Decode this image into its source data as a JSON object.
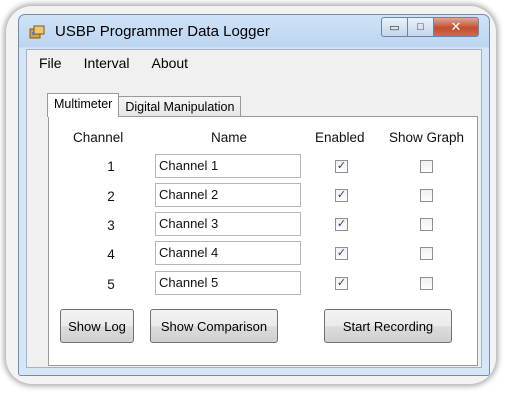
{
  "window": {
    "title": "USBP Programmer Data Logger",
    "minimize_glyph": "▭",
    "maximize_glyph": "□",
    "close_glyph": "✕"
  },
  "menu": [
    "File",
    "Interval",
    "About"
  ],
  "tabs": [
    {
      "label": "Multimeter",
      "active": true
    },
    {
      "label": "Digital Manipulation",
      "active": false
    }
  ],
  "table": {
    "headers": {
      "channel": "Channel",
      "name": "Name",
      "enabled": "Enabled",
      "show_graph": "Show Graph"
    },
    "rows": [
      {
        "channel": "1",
        "name": "Channel 1",
        "enabled": true,
        "show_graph": false
      },
      {
        "channel": "2",
        "name": "Channel 2",
        "enabled": true,
        "show_graph": false
      },
      {
        "channel": "3",
        "name": "Channel 3",
        "enabled": true,
        "show_graph": false
      },
      {
        "channel": "4",
        "name": "Channel 4",
        "enabled": true,
        "show_graph": false
      },
      {
        "channel": "5",
        "name": "Channel 5",
        "enabled": true,
        "show_graph": false
      }
    ]
  },
  "buttons": {
    "show_log": "Show Log",
    "show_comparison": "Show Comparison",
    "start_recording": "Start Recording"
  },
  "icons": {
    "app": "app-icon",
    "checkmark": "✓"
  },
  "colors": {
    "title_bar": "#bcd5f0",
    "close_button": "#c44d2f",
    "checkmark": "#2a3f7c"
  }
}
